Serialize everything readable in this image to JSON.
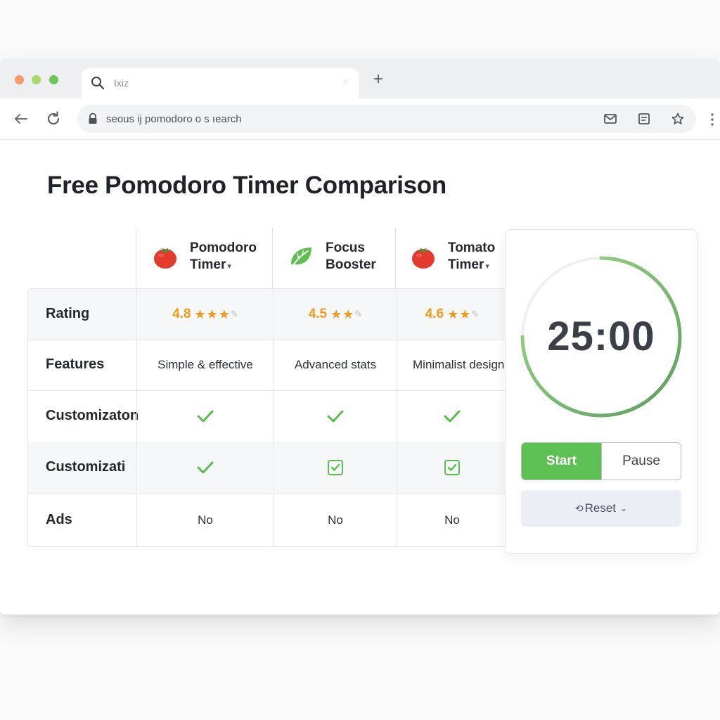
{
  "browser": {
    "tab": {
      "title": "Ixiz"
    },
    "address_bar": {
      "url": "seous ij pomodoro o s ıearch"
    }
  },
  "page": {
    "title": "Free Pomodoro Timer Comparison"
  },
  "comparison": {
    "apps": [
      {
        "name_line1": "Pomodoro",
        "name_line2": "Timer",
        "icon": "tomato-icon",
        "has_caret": true
      },
      {
        "name_line1": "Focus",
        "name_line2": "Booster",
        "icon": "leaf-icon",
        "has_caret": false
      },
      {
        "name_line1": "Tomato",
        "name_line2": "Timer",
        "icon": "tomato-icon",
        "has_caret": true
      }
    ],
    "rows": [
      {
        "label": "Rating",
        "values": [
          "4.8",
          "4.5",
          "4.6"
        ],
        "stars": [
          3,
          2,
          2
        ]
      },
      {
        "label": "Features",
        "values": [
          "Simple & effective",
          "Advanced stats",
          "Minimalist design"
        ]
      },
      {
        "label": "Customizaton",
        "values": [
          "check",
          "check",
          "check"
        ]
      },
      {
        "label": "Customizati",
        "values": [
          "check",
          "checkbox-checked",
          "checkbox-checked"
        ]
      },
      {
        "label": "Ads",
        "values": [
          "No",
          "No",
          "No"
        ]
      }
    ]
  },
  "timer": {
    "time": "25:00",
    "start_label": "Start",
    "pause_label": "Pause",
    "reset_label": "Reset",
    "progress": 0.75,
    "colors": {
      "ring_light": "#9ddb8b",
      "ring_dark": "#5e9c60",
      "start_button": "#5cc052"
    }
  },
  "colors": {
    "accent_orange": "#f39a1a",
    "check_green": "#5dbb4f",
    "tomato_red": "#e23b2e"
  }
}
